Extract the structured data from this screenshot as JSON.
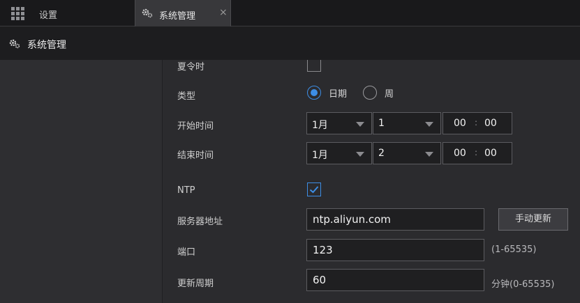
{
  "topbar": {
    "settings_label": "设置",
    "active_tab": {
      "label": "系统管理",
      "close_glyph": "×"
    },
    "icons": [
      "grid-icon",
      "gear-icon",
      "close-icon"
    ]
  },
  "titlebar": {
    "title": "系统管理",
    "icon": "gear-icon"
  },
  "form": {
    "dst_label": "夏令时",
    "dst_checked": false,
    "type_label": "类型",
    "type_options": [
      {
        "label": "日期",
        "selected": true
      },
      {
        "label": "周",
        "selected": false
      }
    ],
    "start": {
      "label": "开始时间",
      "month": "1月",
      "day": "1",
      "hour": "00",
      "minute": "00",
      "sep": ":"
    },
    "end": {
      "label": "结束时间",
      "month": "1月",
      "day": "2",
      "hour": "00",
      "minute": "00",
      "sep": ":"
    },
    "ntp_label": "NTP",
    "ntp_checked": true,
    "server_label": "服务器地址",
    "server_value": "ntp.aliyun.com",
    "update_button": "手动更新",
    "port_label": "端口",
    "port_value": "123",
    "port_hint": "(1-65535)",
    "period_label": "更新周期",
    "period_value": "60",
    "period_hint": "分钟(0-65535)"
  },
  "colors": {
    "accent": "#3d8ee6",
    "background": "#2b2b2e",
    "topbar": "#19191b",
    "titlebar": "#1d1d1f"
  }
}
